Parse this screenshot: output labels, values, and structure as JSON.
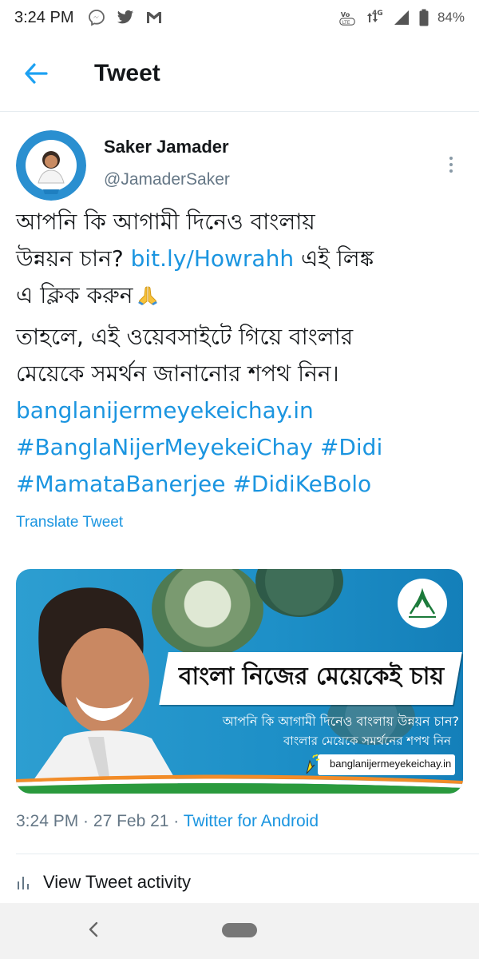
{
  "status_bar": {
    "time": "3:24 PM",
    "battery": "84%",
    "network": "4G",
    "icons": [
      "messenger-icon",
      "twitter-icon",
      "gmail-icon",
      "volte-icon",
      "data-arrows-icon",
      "signal-icon",
      "battery-icon"
    ]
  },
  "header": {
    "title": "Tweet",
    "back_icon": "arrow-left-icon"
  },
  "tweet": {
    "author": {
      "name": "Saker Jamader",
      "handle": "@JamaderSaker"
    },
    "text": {
      "line1": "আপনি কি আগামী দিনেও বাংলায়",
      "line2_pre": "উন্নয়ন চান? ",
      "line2_link": "bit.ly/Howrahh",
      "line2_post": " এই লিঙ্ক",
      "line3": "এ ক্লিক করুন",
      "line4": "তাহলে, এই ওয়েবসাইটে গিয়ে বাংলার",
      "line5": "মেয়েকে সমর্থন জানানোর শপথ নিন।",
      "url": "banglanijermeyekeichay.in",
      "hashtag1": "#BanglaNijerMeyekeiChay",
      "hashtag2": "#Didi",
      "hashtag3": "#MamataBanerjee",
      "hashtag4": "#DidiKeBolo"
    },
    "translate_label": "Translate Tweet",
    "media": {
      "banner_title": "বাংলা নিজের মেয়েকেই চায়",
      "question": "আপনি কি আগামী দিনেও বাংলায় উন্নয়ন চান?",
      "subline": "বাংলার মেয়েকে সমর্থনের শপথ নিন",
      "url": "banglanijermeyekeichay.in"
    },
    "time": "3:24 PM",
    "date": "27 Feb 21",
    "separator": " · ",
    "source": "Twitter for Android",
    "activity_label": "View Tweet activity"
  },
  "colors": {
    "link": "#1b95e0",
    "secondary_text": "#657786",
    "primary_text": "#14171a",
    "media_blue": "#1d8fc7"
  }
}
